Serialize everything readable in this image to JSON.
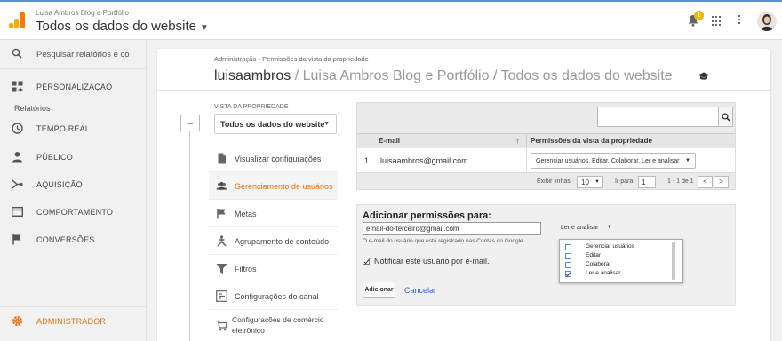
{
  "header": {
    "account_small": "Luisa Ambros Blog e Portfólio",
    "account_big": "Todos os dados do website",
    "notification_count": "1",
    "colors": {
      "logo_orange": "#f57c00",
      "logo_yellow": "#f9ab00",
      "accent": "#e8710a",
      "badge": "#f4b400"
    }
  },
  "sidebar": {
    "search_placeholder": "Pesquisar relatórios e conte",
    "personalization": "PERSONALIZAÇÃO",
    "section_reports": "Relatórios",
    "items": [
      {
        "label": "TEMPO REAL",
        "icon": "clock-icon"
      },
      {
        "label": "PÚBLICO",
        "icon": "person-icon"
      },
      {
        "label": "AQUISIÇÃO",
        "icon": "acquisition-icon"
      },
      {
        "label": "COMPORTAMENTO",
        "icon": "behavior-icon"
      },
      {
        "label": "CONVERSÕES",
        "icon": "flag-icon"
      }
    ],
    "admin": "ADMINISTRADOR"
  },
  "main": {
    "breadcrumb": "Administração › Permissões da vista da propriedade",
    "title_strong": "luisaambros",
    "title_rest": " / Luisa Ambros Blog e Portfólio / Todos os dados do website",
    "property_view_label": "VISTA DA PROPRIEDADE",
    "property_view_value": "Todos os dados do website",
    "nav": [
      {
        "label": "Visualizar configurações",
        "icon": "document-icon"
      },
      {
        "label": "Gerenciamento de usuários",
        "icon": "users-icon",
        "active": true
      },
      {
        "label": "Metas",
        "icon": "flag-icon"
      },
      {
        "label": "Agrupamento de conteúdo",
        "icon": "grouping-icon"
      },
      {
        "label": "Filtros",
        "icon": "filter-icon"
      },
      {
        "label": "Configurações do canal",
        "icon": "channel-icon"
      },
      {
        "label": "Configurações de comércio eletrônico",
        "icon": "cart-icon"
      }
    ]
  },
  "table": {
    "col_email": "E-mail",
    "col_permissions": "Permissões da vista da propriedade",
    "rows": [
      {
        "n": "1.",
        "email": "luisaambros@gmail.com",
        "permissions": "Gerenciar usuários, Editar, Colaborar, Ler e analisar"
      }
    ],
    "rows_label": "Exibir linhas:",
    "rows_value": "10",
    "goto_label": "Ir para:",
    "goto_value": "1",
    "range": "1 - 1 de 1"
  },
  "add_permissions": {
    "title": "Adicionar permissões para:",
    "email_value": "email-do-terceiro@gmail.com",
    "hint": "O e-mail do usuário que está registrado nas Contas do Google.",
    "notify_label": "Notificar este usuário por e-mail.",
    "notify_checked": true,
    "add_button": "Adicionar",
    "cancel_button": "Cancelar",
    "role_selected": "Ler e analisar",
    "role_options": [
      {
        "label": "Gerenciar usuários",
        "checked": false
      },
      {
        "label": "Editar",
        "checked": false
      },
      {
        "label": "Colaborar",
        "checked": false
      },
      {
        "label": "Ler e analisar",
        "checked": true
      }
    ]
  }
}
